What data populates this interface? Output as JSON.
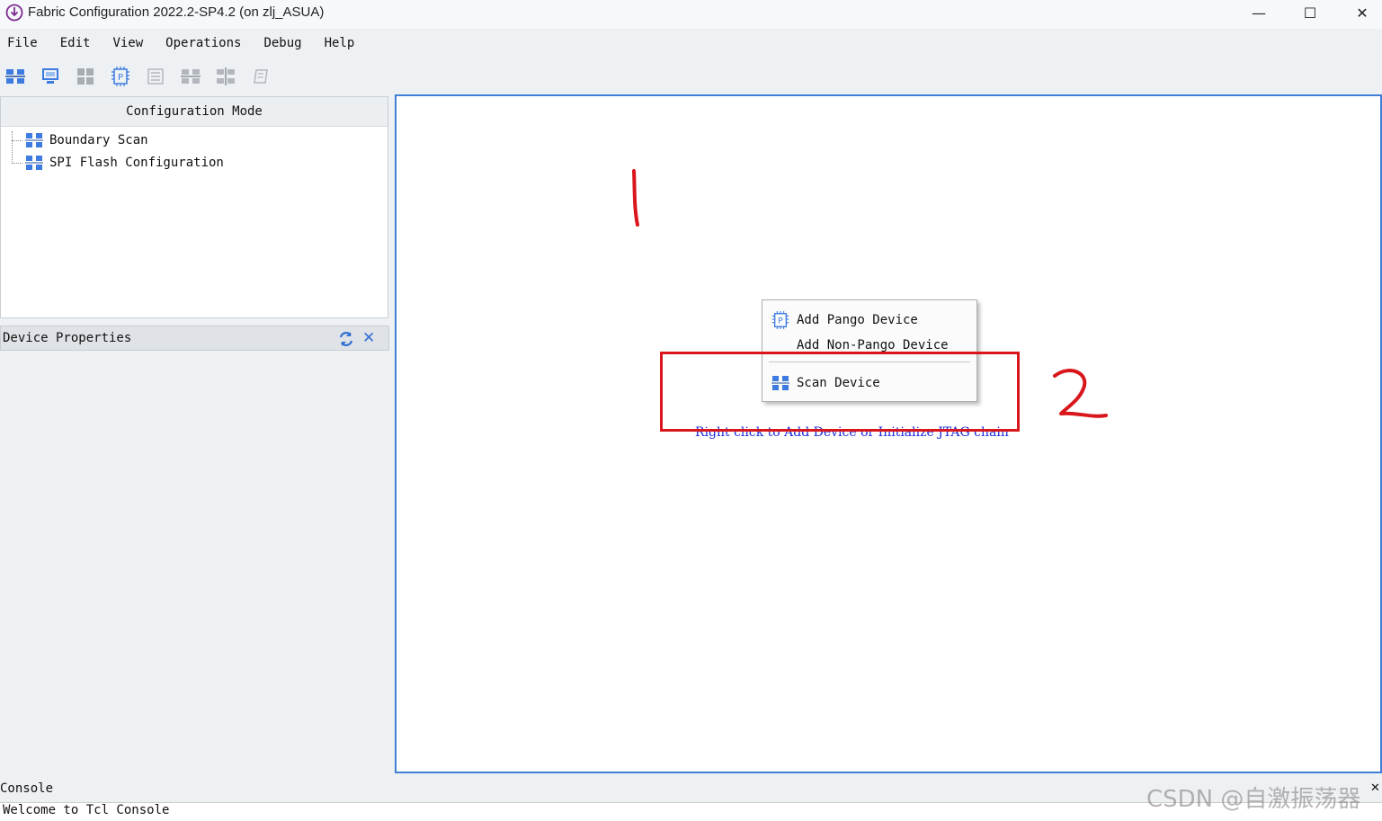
{
  "window": {
    "title": "Fabric Configuration 2022.2-SP4.2 (on zlj_ASUA)",
    "controls": [
      "minimize-icon",
      "maximize-icon",
      "close-icon"
    ],
    "minimize_glyph": "—",
    "maximize_glyph": "☐",
    "close_glyph": "✕"
  },
  "menubar": [
    "File",
    "Edit",
    "View",
    "Operations",
    "Debug",
    "Help"
  ],
  "toolbar": [
    "scan-chain-icon",
    "monitor-icon",
    "grid-icon",
    "chip-icon",
    "list-icon",
    "chain-icon",
    "chain-alt-icon",
    "edit-icon"
  ],
  "config_panel": {
    "title": "Configuration Mode",
    "items": [
      "Boundary Scan",
      "SPI Flash Configuration"
    ]
  },
  "device_properties": {
    "title": "Device Properties",
    "refresh_icon": "refresh-icon",
    "close_glyph": "✕"
  },
  "canvas": {
    "hint": "Right click to Add Device or Initialize JTAG chain"
  },
  "context_menu": {
    "items": [
      {
        "label": "Add Pango Device",
        "icon": "chip-icon"
      },
      {
        "label": "Add Non-Pango Device",
        "icon": ""
      },
      {
        "label": "Scan Device",
        "icon": "scan-chain-icon"
      }
    ]
  },
  "annotations": {
    "mark_1": "1",
    "mark_2": "2",
    "color": "#d9161b"
  },
  "console": {
    "title": "Console",
    "text": "Welcome to Tcl Console",
    "corner_glyph": "✕"
  },
  "watermark": "CSDN @自激振荡器",
  "colors": {
    "accent": "#3f7fd6",
    "hint": "#1a2bd9",
    "annotation": "#d9161b",
    "icon_blue": "#3d7be0"
  }
}
